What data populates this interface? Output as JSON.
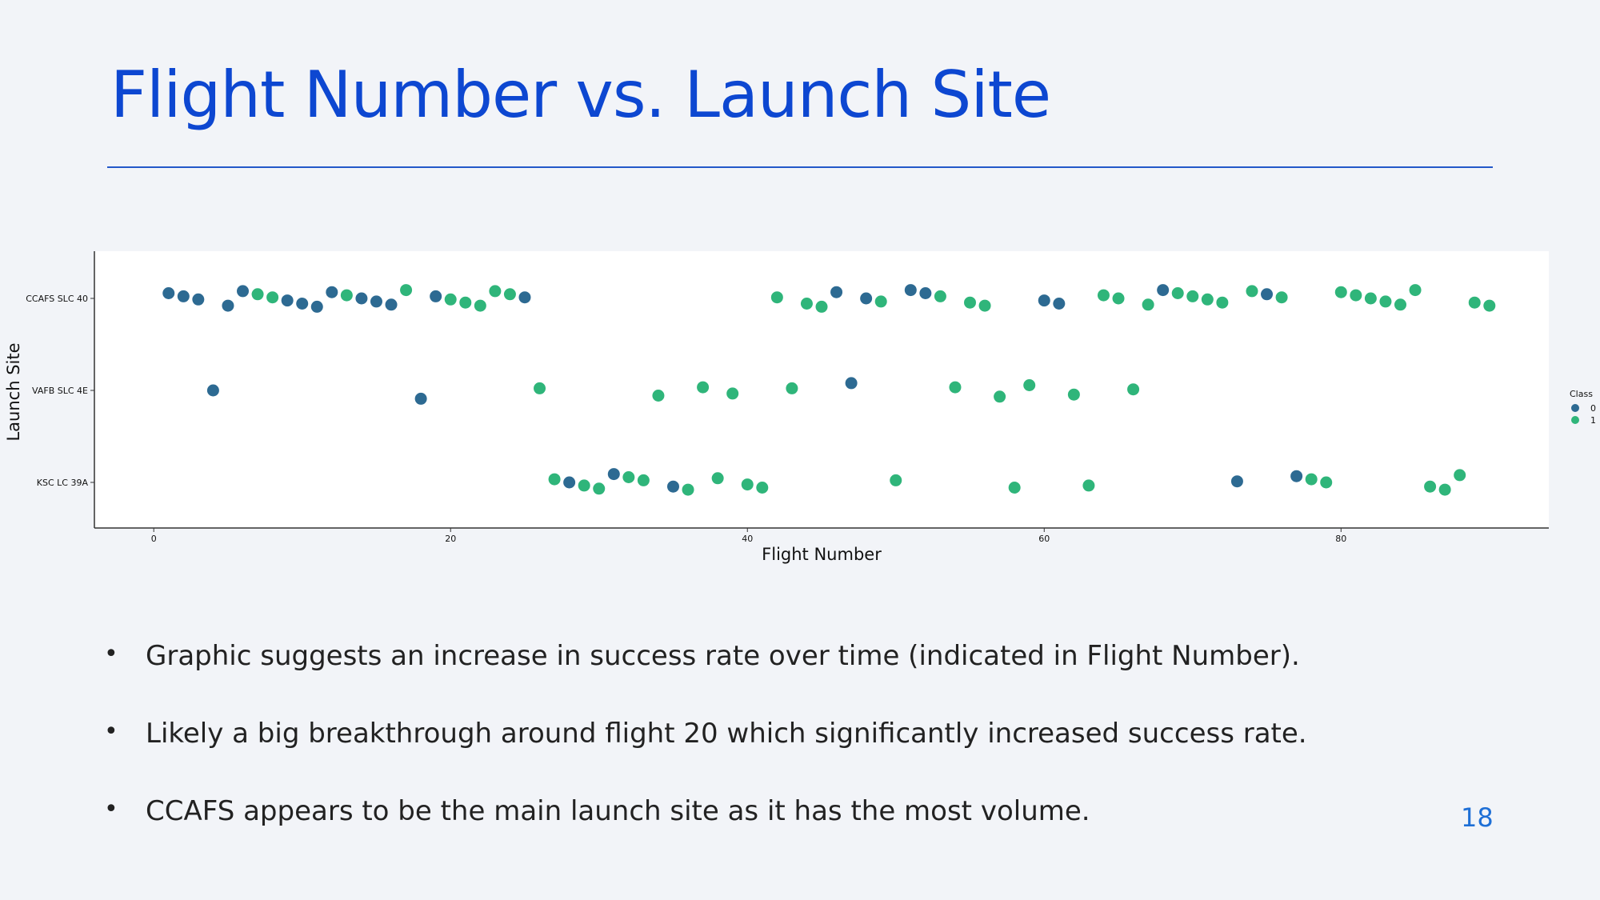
{
  "slide": {
    "title": "Flight Number vs. Launch Site",
    "bullets": [
      "Graphic suggests an increase in success rate over time (indicated in Flight Number).",
      "Likely a big breakthrough around flight 20 which significantly increased success rate.",
      "CCAFS appears to be the main launch site as it has the most volume."
    ],
    "page_number": "18"
  },
  "colors": {
    "class_0": "#2d6a92",
    "class_1": "#2fb57a",
    "title": "#0d47d1",
    "page_number": "#1e6fd6"
  },
  "chart_data": {
    "type": "scatter",
    "title": "",
    "xlabel": "Flight Number",
    "ylabel": "Launch Site",
    "categories": [
      "CCAFS SLC 40",
      "VAFB SLC 4E",
      "KSC LC 39A"
    ],
    "xlim": [
      -4,
      94
    ],
    "xticks": [
      0,
      20,
      40,
      60,
      80
    ],
    "legend": {
      "title": "Class",
      "placement": "right",
      "labels": [
        "0",
        "1"
      ]
    },
    "grid": false,
    "series": [
      {
        "name": "0",
        "points": [
          {
            "x": 1,
            "site": "CCAFS SLC 40"
          },
          {
            "x": 2,
            "site": "CCAFS SLC 40"
          },
          {
            "x": 3,
            "site": "CCAFS SLC 40"
          },
          {
            "x": 4,
            "site": "VAFB SLC 4E"
          },
          {
            "x": 5,
            "site": "CCAFS SLC 40"
          },
          {
            "x": 6,
            "site": "CCAFS SLC 40"
          },
          {
            "x": 9,
            "site": "CCAFS SLC 40"
          },
          {
            "x": 10,
            "site": "CCAFS SLC 40"
          },
          {
            "x": 11,
            "site": "CCAFS SLC 40"
          },
          {
            "x": 12,
            "site": "CCAFS SLC 40"
          },
          {
            "x": 14,
            "site": "CCAFS SLC 40"
          },
          {
            "x": 15,
            "site": "CCAFS SLC 40"
          },
          {
            "x": 16,
            "site": "CCAFS SLC 40"
          },
          {
            "x": 18,
            "site": "VAFB SLC 4E"
          },
          {
            "x": 19,
            "site": "CCAFS SLC 40"
          },
          {
            "x": 25,
            "site": "CCAFS SLC 40"
          },
          {
            "x": 28,
            "site": "KSC LC 39A"
          },
          {
            "x": 31,
            "site": "KSC LC 39A"
          },
          {
            "x": 35,
            "site": "KSC LC 39A"
          },
          {
            "x": 46,
            "site": "CCAFS SLC 40"
          },
          {
            "x": 47,
            "site": "VAFB SLC 4E"
          },
          {
            "x": 48,
            "site": "CCAFS SLC 40"
          },
          {
            "x": 51,
            "site": "CCAFS SLC 40"
          },
          {
            "x": 52,
            "site": "CCAFS SLC 40"
          },
          {
            "x": 60,
            "site": "CCAFS SLC 40"
          },
          {
            "x": 61,
            "site": "CCAFS SLC 40"
          },
          {
            "x": 68,
            "site": "CCAFS SLC 40"
          },
          {
            "x": 73,
            "site": "KSC LC 39A"
          },
          {
            "x": 75,
            "site": "CCAFS SLC 40"
          },
          {
            "x": 77,
            "site": "KSC LC 39A"
          }
        ]
      },
      {
        "name": "1",
        "points": [
          {
            "x": 7,
            "site": "CCAFS SLC 40"
          },
          {
            "x": 8,
            "site": "CCAFS SLC 40"
          },
          {
            "x": 13,
            "site": "CCAFS SLC 40"
          },
          {
            "x": 17,
            "site": "CCAFS SLC 40"
          },
          {
            "x": 20,
            "site": "CCAFS SLC 40"
          },
          {
            "x": 21,
            "site": "CCAFS SLC 40"
          },
          {
            "x": 22,
            "site": "CCAFS SLC 40"
          },
          {
            "x": 23,
            "site": "CCAFS SLC 40"
          },
          {
            "x": 24,
            "site": "CCAFS SLC 40"
          },
          {
            "x": 26,
            "site": "VAFB SLC 4E"
          },
          {
            "x": 27,
            "site": "KSC LC 39A"
          },
          {
            "x": 29,
            "site": "KSC LC 39A"
          },
          {
            "x": 30,
            "site": "KSC LC 39A"
          },
          {
            "x": 32,
            "site": "KSC LC 39A"
          },
          {
            "x": 33,
            "site": "KSC LC 39A"
          },
          {
            "x": 34,
            "site": "VAFB SLC 4E"
          },
          {
            "x": 36,
            "site": "KSC LC 39A"
          },
          {
            "x": 37,
            "site": "VAFB SLC 4E"
          },
          {
            "x": 38,
            "site": "KSC LC 39A"
          },
          {
            "x": 39,
            "site": "VAFB SLC 4E"
          },
          {
            "x": 40,
            "site": "KSC LC 39A"
          },
          {
            "x": 41,
            "site": "KSC LC 39A"
          },
          {
            "x": 42,
            "site": "CCAFS SLC 40"
          },
          {
            "x": 43,
            "site": "VAFB SLC 4E"
          },
          {
            "x": 44,
            "site": "CCAFS SLC 40"
          },
          {
            "x": 45,
            "site": "CCAFS SLC 40"
          },
          {
            "x": 49,
            "site": "CCAFS SLC 40"
          },
          {
            "x": 50,
            "site": "KSC LC 39A"
          },
          {
            "x": 53,
            "site": "CCAFS SLC 40"
          },
          {
            "x": 54,
            "site": "VAFB SLC 4E"
          },
          {
            "x": 55,
            "site": "CCAFS SLC 40"
          },
          {
            "x": 56,
            "site": "CCAFS SLC 40"
          },
          {
            "x": 57,
            "site": "VAFB SLC 4E"
          },
          {
            "x": 58,
            "site": "KSC LC 39A"
          },
          {
            "x": 59,
            "site": "VAFB SLC 4E"
          },
          {
            "x": 62,
            "site": "VAFB SLC 4E"
          },
          {
            "x": 63,
            "site": "KSC LC 39A"
          },
          {
            "x": 64,
            "site": "CCAFS SLC 40"
          },
          {
            "x": 65,
            "site": "CCAFS SLC 40"
          },
          {
            "x": 66,
            "site": "VAFB SLC 4E"
          },
          {
            "x": 67,
            "site": "CCAFS SLC 40"
          },
          {
            "x": 69,
            "site": "CCAFS SLC 40"
          },
          {
            "x": 70,
            "site": "CCAFS SLC 40"
          },
          {
            "x": 71,
            "site": "CCAFS SLC 40"
          },
          {
            "x": 72,
            "site": "CCAFS SLC 40"
          },
          {
            "x": 74,
            "site": "CCAFS SLC 40"
          },
          {
            "x": 76,
            "site": "CCAFS SLC 40"
          },
          {
            "x": 78,
            "site": "KSC LC 39A"
          },
          {
            "x": 79,
            "site": "KSC LC 39A"
          },
          {
            "x": 80,
            "site": "CCAFS SLC 40"
          },
          {
            "x": 81,
            "site": "CCAFS SLC 40"
          },
          {
            "x": 82,
            "site": "CCAFS SLC 40"
          },
          {
            "x": 83,
            "site": "CCAFS SLC 40"
          },
          {
            "x": 84,
            "site": "CCAFS SLC 40"
          },
          {
            "x": 85,
            "site": "CCAFS SLC 40"
          },
          {
            "x": 86,
            "site": "KSC LC 39A"
          },
          {
            "x": 87,
            "site": "KSC LC 39A"
          },
          {
            "x": 88,
            "site": "KSC LC 39A"
          },
          {
            "x": 89,
            "site": "CCAFS SLC 40"
          },
          {
            "x": 90,
            "site": "CCAFS SLC 40"
          }
        ]
      }
    ]
  }
}
